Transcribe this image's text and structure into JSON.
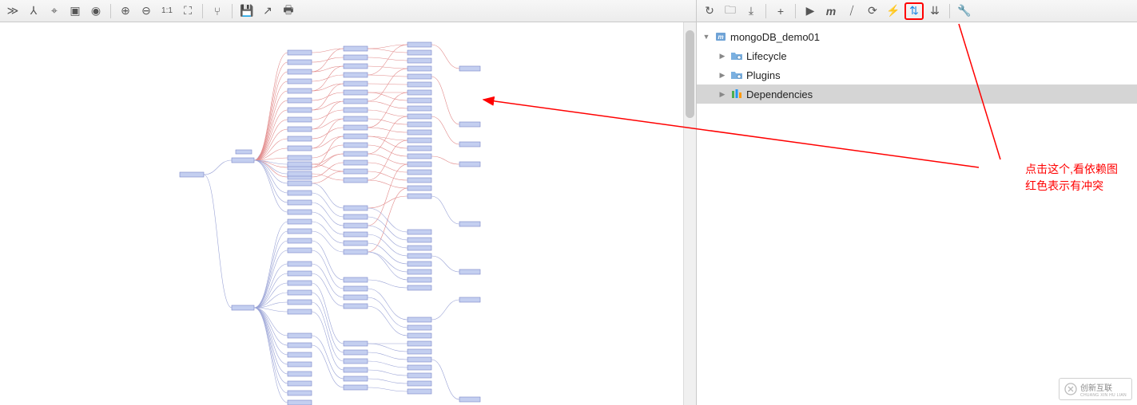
{
  "left_toolbar": {
    "items": [
      {
        "name": "overflow-icon",
        "glyph": "≫"
      },
      {
        "name": "tree-icon",
        "glyph": "⅄"
      },
      {
        "name": "zoom-select-icon",
        "glyph": "⌖"
      },
      {
        "name": "fit-selection-icon",
        "glyph": "▣"
      },
      {
        "name": "eye-icon",
        "glyph": "◉"
      },
      {
        "sep": true
      },
      {
        "name": "zoom-in-icon",
        "glyph": "⊕"
      },
      {
        "name": "zoom-out-icon",
        "glyph": "⊖"
      },
      {
        "name": "actual-size-icon",
        "glyph": "1:1"
      },
      {
        "name": "fit-content-icon",
        "glyph": "⛶"
      },
      {
        "sep": true
      },
      {
        "name": "share-icon",
        "glyph": "⑂"
      },
      {
        "sep": true
      },
      {
        "name": "save-icon",
        "glyph": "💾"
      },
      {
        "name": "export-icon",
        "glyph": "↗"
      },
      {
        "name": "print-icon",
        "glyph": "🖶"
      }
    ]
  },
  "right_toolbar": {
    "items": [
      {
        "name": "refresh-icon",
        "glyph": "↻"
      },
      {
        "name": "generate-sources-icon",
        "glyph": "🗀"
      },
      {
        "name": "download-icon",
        "glyph": "⤓"
      },
      {
        "sep": true
      },
      {
        "name": "add-icon",
        "glyph": "+"
      },
      {
        "sep": true
      },
      {
        "name": "run-icon",
        "glyph": "▶"
      },
      {
        "name": "maven-icon",
        "glyph": "m",
        "italic": true
      },
      {
        "name": "toggle-offline-icon",
        "glyph": "⧸"
      },
      {
        "name": "reimport-icon",
        "glyph": "⟳"
      },
      {
        "name": "skip-tests-icon",
        "glyph": "⚡",
        "accent": "#1e88e5"
      },
      {
        "name": "show-dependencies-icon",
        "glyph": "⇅",
        "highlight": true,
        "accent": "#1e88e5"
      },
      {
        "name": "collapse-all-icon",
        "glyph": "⇊"
      },
      {
        "sep": true
      },
      {
        "name": "settings-icon",
        "glyph": "🔧"
      }
    ]
  },
  "tree": {
    "root": {
      "label": "mongoDB_demo01",
      "icon": "maven-module-icon",
      "expanded": true
    },
    "children": [
      {
        "label": "Lifecycle",
        "icon": "folder-gear-icon",
        "expanded": false
      },
      {
        "label": "Plugins",
        "icon": "folder-gear-icon",
        "expanded": false
      },
      {
        "label": "Dependencies",
        "icon": "dependencies-icon",
        "expanded": false,
        "selected": true
      }
    ]
  },
  "annotation": {
    "line1": "点击这个,看依赖图",
    "line2": "红色表示有冲突"
  },
  "watermark": {
    "text": "创新互联",
    "sub": "CHUANG XIN HU LIAN"
  }
}
